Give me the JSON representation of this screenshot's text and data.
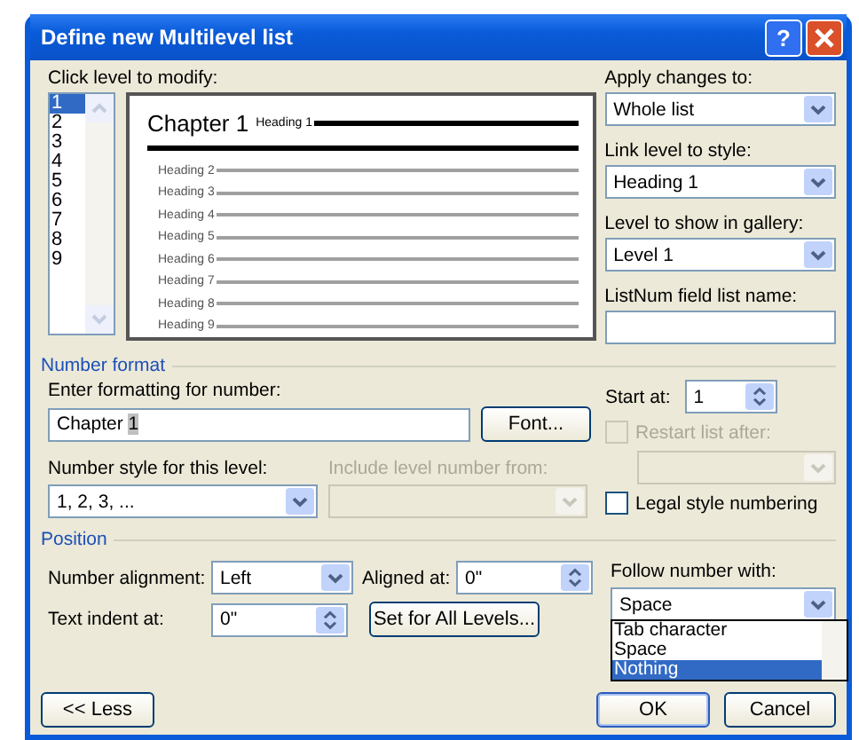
{
  "window": {
    "title": "Define new Multilevel list",
    "help": "?"
  },
  "level_picker": {
    "label": "Click level to modify:",
    "levels": [
      {
        "label": "1",
        "selected": true
      },
      {
        "label": "2",
        "selected": false
      },
      {
        "label": "3",
        "selected": false
      },
      {
        "label": "4",
        "selected": false
      },
      {
        "label": "5",
        "selected": false
      },
      {
        "label": "6",
        "selected": false
      },
      {
        "label": "7",
        "selected": false
      },
      {
        "label": "8",
        "selected": false
      },
      {
        "label": "9",
        "selected": false
      }
    ]
  },
  "preview": {
    "number": "Chapter 1",
    "first_heading": "Heading 1",
    "headings": [
      "Heading 2",
      "Heading 3",
      "Heading 4",
      "Heading 5",
      "Heading 6",
      "Heading 7",
      "Heading 8",
      "Heading 9"
    ]
  },
  "right_fields": [
    {
      "label": "Apply changes to:",
      "kind": "dropdown",
      "value": "Whole list"
    },
    {
      "label": "Link level to style:",
      "kind": "dropdown",
      "value": "Heading 1"
    },
    {
      "label": "Level to show in gallery:",
      "kind": "dropdown",
      "value": "Level 1"
    },
    {
      "label": "ListNum field list name:",
      "kind": "text"
    }
  ],
  "number_format": {
    "title": "Number format",
    "format_label": "Enter formatting for number:",
    "format_text": "Chapter ",
    "format_field": "1",
    "font_button": "Font...",
    "style_label": "Number style for this level:",
    "style_value": "1, 2, 3, ...",
    "include_label": "Include level number from:",
    "include_disabled": true,
    "start_label": "Start at:",
    "start_value": "1",
    "restart_label": "Restart list after:",
    "restart_checked": false,
    "restart_disabled": true,
    "legal_label": "Legal style numbering",
    "legal_checked": false
  },
  "position": {
    "title": "Position",
    "alignment_label": "Number alignment:",
    "alignment_value": "Left",
    "aligned_label": "Aligned at:",
    "aligned_value": "0\"",
    "indent_label": "Text indent at:",
    "indent_value": "0\"",
    "set_all_button": "Set for All Levels...",
    "follow_label": "Follow number with:",
    "follow_value": "Space",
    "follow_expanded": true,
    "follow_options": [
      {
        "label": "Tab character",
        "selected": false
      },
      {
        "label": "Space",
        "selected": false
      },
      {
        "label": "Nothing",
        "selected": true
      }
    ]
  },
  "buttons": {
    "less": "<< Less",
    "ok": "OK",
    "cancel": "Cancel"
  }
}
